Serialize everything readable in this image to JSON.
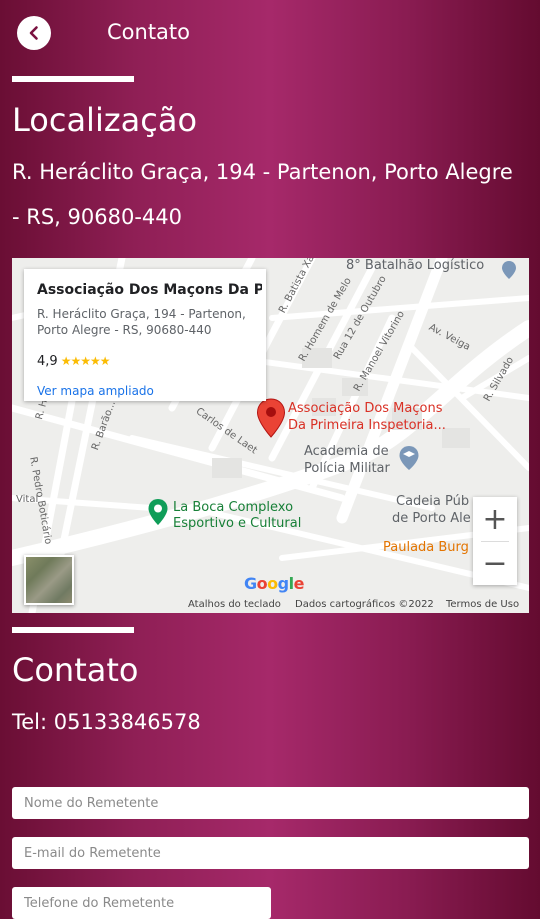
{
  "header": {
    "title": "Contato"
  },
  "location": {
    "heading": "Localização",
    "address": "R. Heráclito Graça, 194 - Partenon, Porto Alegre - RS, 90680-440"
  },
  "map": {
    "info_card": {
      "name": "Associação Dos Maçons Da P...",
      "address": "R. Heráclito Graça, 194 - Partenon, Porto Alegre - RS, 90680-440",
      "rating": "4,9",
      "stars": "★★★★★",
      "link": "Ver mapa ampliado"
    },
    "pin_label_line1": "Associação Dos Maçons",
    "pin_label_line2": "Da Primeira Inspetoria...",
    "places": {
      "batalhao": "8° Batalhão Logístico",
      "academia_line1": "Academia de",
      "academia_line2": "Polícia Militar",
      "laboca_line1": "La Boca Complexo",
      "laboca_line2": "Esportivo e Cultural",
      "cadeia_line1": "Cadeia Púb",
      "cadeia_line2": "de Porto Ale",
      "paulada": "Paulada Burg"
    },
    "streets": {
      "batista": "R. Batista Xavier",
      "homem": "R. Homem de Melo",
      "rua12": "Rua 12 de Outubro",
      "manoel": "R. Manoel Vitorino",
      "veiga": "Av. Veiga",
      "silvado": "R. Silvado",
      "barao": "R. Barão...",
      "carlos": "Carlos de Laet",
      "pedro": "R. Pedro Boticário",
      "vital": "Vital",
      "ha": "R. Ha"
    },
    "google": "Google",
    "footer": {
      "shortcuts": "Atalhos do teclado",
      "data": "Dados cartográficos ©2022",
      "terms": "Termos de Uso"
    },
    "zoom_in": "+",
    "zoom_out": "−"
  },
  "contact": {
    "heading": "Contato",
    "phone": "Tel: 05133846578"
  },
  "form": {
    "name_placeholder": "Nome do Remetente",
    "email_placeholder": "E-mail do Remetente",
    "phone_placeholder": "Telefone do Remetente"
  },
  "colors": {
    "background_left": "#6a0e34",
    "background_center": "#a6296a",
    "pin": "#ea4335",
    "place_green": "#0f9d58",
    "link_blue": "#1a73e8"
  }
}
